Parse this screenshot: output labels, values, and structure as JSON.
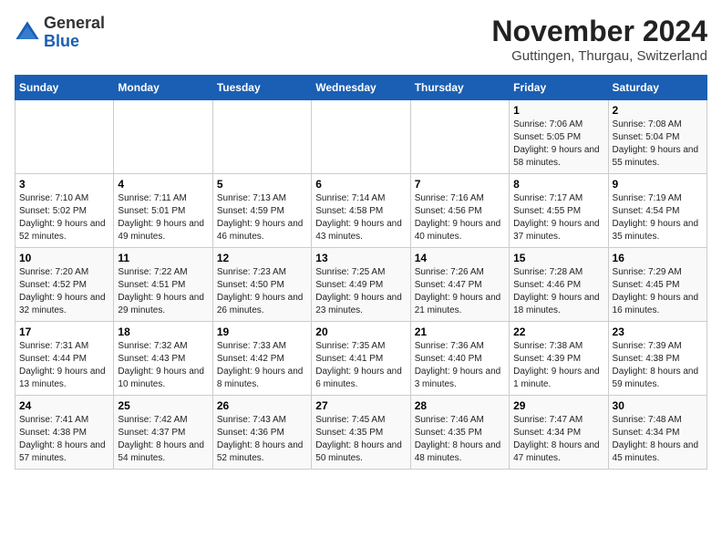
{
  "header": {
    "logo_line1": "General",
    "logo_line2": "Blue",
    "month": "November 2024",
    "location": "Guttingen, Thurgau, Switzerland"
  },
  "days_of_week": [
    "Sunday",
    "Monday",
    "Tuesday",
    "Wednesday",
    "Thursday",
    "Friday",
    "Saturday"
  ],
  "weeks": [
    [
      {
        "day": "",
        "info": ""
      },
      {
        "day": "",
        "info": ""
      },
      {
        "day": "",
        "info": ""
      },
      {
        "day": "",
        "info": ""
      },
      {
        "day": "",
        "info": ""
      },
      {
        "day": "1",
        "info": "Sunrise: 7:06 AM\nSunset: 5:05 PM\nDaylight: 9 hours and 58 minutes."
      },
      {
        "day": "2",
        "info": "Sunrise: 7:08 AM\nSunset: 5:04 PM\nDaylight: 9 hours and 55 minutes."
      }
    ],
    [
      {
        "day": "3",
        "info": "Sunrise: 7:10 AM\nSunset: 5:02 PM\nDaylight: 9 hours and 52 minutes."
      },
      {
        "day": "4",
        "info": "Sunrise: 7:11 AM\nSunset: 5:01 PM\nDaylight: 9 hours and 49 minutes."
      },
      {
        "day": "5",
        "info": "Sunrise: 7:13 AM\nSunset: 4:59 PM\nDaylight: 9 hours and 46 minutes."
      },
      {
        "day": "6",
        "info": "Sunrise: 7:14 AM\nSunset: 4:58 PM\nDaylight: 9 hours and 43 minutes."
      },
      {
        "day": "7",
        "info": "Sunrise: 7:16 AM\nSunset: 4:56 PM\nDaylight: 9 hours and 40 minutes."
      },
      {
        "day": "8",
        "info": "Sunrise: 7:17 AM\nSunset: 4:55 PM\nDaylight: 9 hours and 37 minutes."
      },
      {
        "day": "9",
        "info": "Sunrise: 7:19 AM\nSunset: 4:54 PM\nDaylight: 9 hours and 35 minutes."
      }
    ],
    [
      {
        "day": "10",
        "info": "Sunrise: 7:20 AM\nSunset: 4:52 PM\nDaylight: 9 hours and 32 minutes."
      },
      {
        "day": "11",
        "info": "Sunrise: 7:22 AM\nSunset: 4:51 PM\nDaylight: 9 hours and 29 minutes."
      },
      {
        "day": "12",
        "info": "Sunrise: 7:23 AM\nSunset: 4:50 PM\nDaylight: 9 hours and 26 minutes."
      },
      {
        "day": "13",
        "info": "Sunrise: 7:25 AM\nSunset: 4:49 PM\nDaylight: 9 hours and 23 minutes."
      },
      {
        "day": "14",
        "info": "Sunrise: 7:26 AM\nSunset: 4:47 PM\nDaylight: 9 hours and 21 minutes."
      },
      {
        "day": "15",
        "info": "Sunrise: 7:28 AM\nSunset: 4:46 PM\nDaylight: 9 hours and 18 minutes."
      },
      {
        "day": "16",
        "info": "Sunrise: 7:29 AM\nSunset: 4:45 PM\nDaylight: 9 hours and 16 minutes."
      }
    ],
    [
      {
        "day": "17",
        "info": "Sunrise: 7:31 AM\nSunset: 4:44 PM\nDaylight: 9 hours and 13 minutes."
      },
      {
        "day": "18",
        "info": "Sunrise: 7:32 AM\nSunset: 4:43 PM\nDaylight: 9 hours and 10 minutes."
      },
      {
        "day": "19",
        "info": "Sunrise: 7:33 AM\nSunset: 4:42 PM\nDaylight: 9 hours and 8 minutes."
      },
      {
        "day": "20",
        "info": "Sunrise: 7:35 AM\nSunset: 4:41 PM\nDaylight: 9 hours and 6 minutes."
      },
      {
        "day": "21",
        "info": "Sunrise: 7:36 AM\nSunset: 4:40 PM\nDaylight: 9 hours and 3 minutes."
      },
      {
        "day": "22",
        "info": "Sunrise: 7:38 AM\nSunset: 4:39 PM\nDaylight: 9 hours and 1 minute."
      },
      {
        "day": "23",
        "info": "Sunrise: 7:39 AM\nSunset: 4:38 PM\nDaylight: 8 hours and 59 minutes."
      }
    ],
    [
      {
        "day": "24",
        "info": "Sunrise: 7:41 AM\nSunset: 4:38 PM\nDaylight: 8 hours and 57 minutes."
      },
      {
        "day": "25",
        "info": "Sunrise: 7:42 AM\nSunset: 4:37 PM\nDaylight: 8 hours and 54 minutes."
      },
      {
        "day": "26",
        "info": "Sunrise: 7:43 AM\nSunset: 4:36 PM\nDaylight: 8 hours and 52 minutes."
      },
      {
        "day": "27",
        "info": "Sunrise: 7:45 AM\nSunset: 4:35 PM\nDaylight: 8 hours and 50 minutes."
      },
      {
        "day": "28",
        "info": "Sunrise: 7:46 AM\nSunset: 4:35 PM\nDaylight: 8 hours and 48 minutes."
      },
      {
        "day": "29",
        "info": "Sunrise: 7:47 AM\nSunset: 4:34 PM\nDaylight: 8 hours and 47 minutes."
      },
      {
        "day": "30",
        "info": "Sunrise: 7:48 AM\nSunset: 4:34 PM\nDaylight: 8 hours and 45 minutes."
      }
    ]
  ]
}
